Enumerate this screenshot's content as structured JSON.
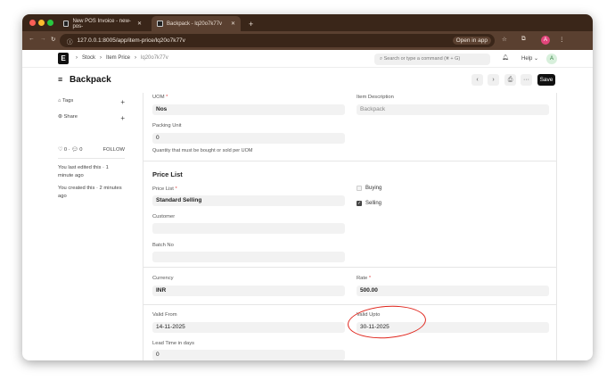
{
  "browser": {
    "tabs": [
      {
        "title": "New POS Invoice - new-pos-"
      },
      {
        "title": "Backpack - lq20o7k77v"
      }
    ],
    "url": "127.0.0.1:8005/app/item-price/lq20o7k77v",
    "open_in_app": "Open in app",
    "profile": "A"
  },
  "navbar": {
    "logo": "E",
    "breadcrumbs": [
      "Stock",
      "Item Price",
      "lq20o7k77v"
    ],
    "search_placeholder": "Search or type a command (⌘ + G)",
    "help": "Help",
    "avatar": "A"
  },
  "page": {
    "title": "Backpack",
    "save_label": "Save"
  },
  "sidebar": {
    "tags": "Tags",
    "share": "Share",
    "likes": "0",
    "comments": "0",
    "follow": "FOLLOW",
    "edited": "You last edited this · 1 minute ago",
    "created": "You created this · 2 minutes ago"
  },
  "form": {
    "uom": {
      "label": "UOM",
      "value": "Nos"
    },
    "item_description": {
      "label": "Item Description",
      "value": "Backpack"
    },
    "packing_unit": {
      "label": "Packing Unit",
      "value": "0",
      "help": "Quantity that must be bought or sold per UOM"
    },
    "price_list_section": "Price List",
    "price_list": {
      "label": "Price List",
      "value": "Standard Selling"
    },
    "buying": {
      "label": "Buying",
      "checked": false
    },
    "selling": {
      "label": "Selling",
      "checked": true
    },
    "customer": {
      "label": "Customer",
      "value": ""
    },
    "batch_no": {
      "label": "Batch No",
      "value": ""
    },
    "currency": {
      "label": "Currency",
      "value": "INR"
    },
    "rate": {
      "label": "Rate",
      "value": "500.00"
    },
    "valid_from": {
      "label": "Valid From",
      "value": "14-11-2025"
    },
    "valid_upto": {
      "label": "Valid Upto",
      "value": "30-11-2025"
    },
    "lead_time": {
      "label": "Lead Time in days",
      "value": "0"
    }
  },
  "annotation_color": "#e0271e"
}
